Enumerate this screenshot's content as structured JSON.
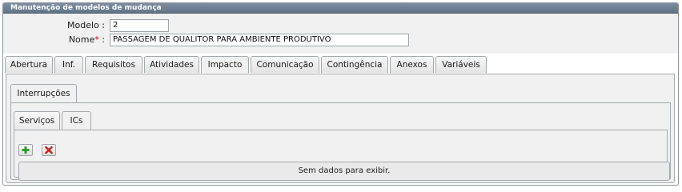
{
  "panel": {
    "title": "Manutenção de modelos de mudança"
  },
  "form": {
    "modelo": {
      "label": "Modelo :",
      "value": "2"
    },
    "nome": {
      "label": "Nome",
      "required_mark": "*",
      "colon": ":",
      "value": "PASSAGEM DE QUALITOR PARA AMBIENTE PRODUTIVO"
    }
  },
  "tabs": [
    {
      "label": "Abertura"
    },
    {
      "label": "Inf."
    },
    {
      "label": "Requisitos"
    },
    {
      "label": "Atividades"
    },
    {
      "label": "Impacto",
      "active": true
    },
    {
      "label": "Comunicação"
    },
    {
      "label": "Contingência"
    },
    {
      "label": "Anexos"
    },
    {
      "label": "Variáveis"
    }
  ],
  "impacto": {
    "subtab": {
      "label": "Interrupções",
      "active": true
    },
    "inner_tabs": [
      {
        "label": "Serviços"
      },
      {
        "label": "ICs",
        "active": true
      }
    ],
    "toolbar": {
      "add_icon": "plus-icon",
      "delete_icon": "delete-icon"
    },
    "grid": {
      "empty_message": "Sem dados para exibir."
    }
  },
  "colors": {
    "header": "#6e8093",
    "required": "#cc0000",
    "add": "#2e9b2e",
    "delete": "#d12020"
  }
}
